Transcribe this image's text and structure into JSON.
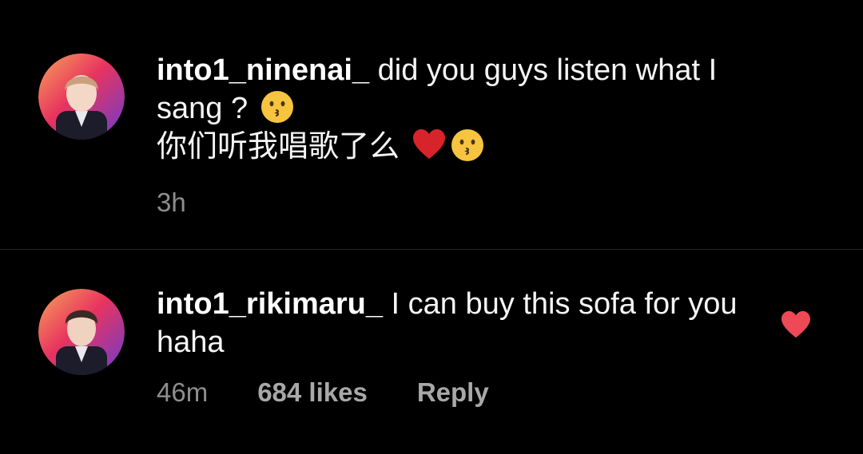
{
  "comments": [
    {
      "username": "into1_ninenai_",
      "text_line1": " did you guys listen what I sang ?",
      "text_line2": "你们听我唱歌了么",
      "emoji1": "kissing-face",
      "emoji2": "red-heart",
      "emoji3": "kissing-face",
      "time": "3h",
      "avatar": "avatar"
    },
    {
      "username": "into1_rikimaru_",
      "text": " I can buy this sofa for you haha",
      "time": "46m",
      "likes": "684 likes",
      "reply": "Reply",
      "liked": true,
      "like_icon": "heart-filled-icon",
      "like_color": "#ed4956"
    }
  ]
}
